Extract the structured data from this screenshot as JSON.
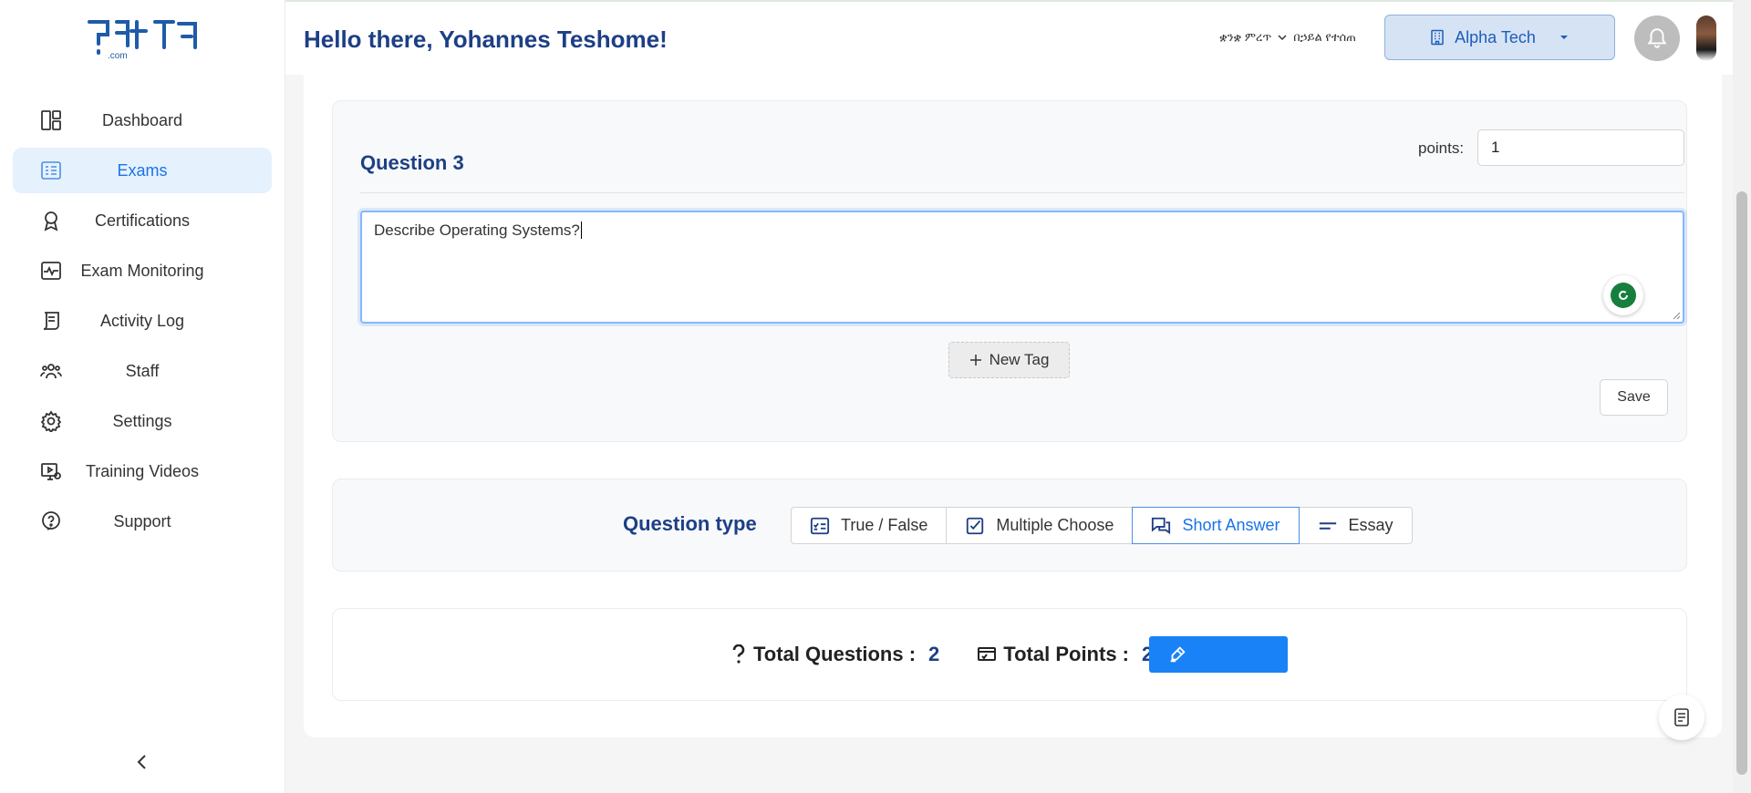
{
  "header": {
    "greeting": "Hello there, Yohannes Teshome!",
    "language_label": "ቋንቋ ምረጥ",
    "language_value": "በኃይል የተሰጠ",
    "org_name": "Alpha Tech"
  },
  "logo": {
    "text": "ፕሬተና",
    "suffix": ".com"
  },
  "sidebar": {
    "items": [
      {
        "label": "Dashboard",
        "icon": "dashboard-icon",
        "active": false
      },
      {
        "label": "Exams",
        "icon": "exams-icon",
        "active": true
      },
      {
        "label": "Certifications",
        "icon": "certificate-icon",
        "active": false
      },
      {
        "label": "Exam Monitoring",
        "icon": "monitoring-icon",
        "active": false
      },
      {
        "label": "Activity Log",
        "icon": "activity-log-icon",
        "active": false
      },
      {
        "label": "Staff",
        "icon": "staff-icon",
        "active": false
      },
      {
        "label": "Settings",
        "icon": "settings-icon",
        "active": false
      },
      {
        "label": "Training Videos",
        "icon": "training-videos-icon",
        "active": false
      },
      {
        "label": "Support",
        "icon": "support-icon",
        "active": false
      }
    ],
    "collapse_icon": "chevron-left-icon"
  },
  "question": {
    "title": "Question 3",
    "points_label": "points:",
    "points_value": "1",
    "text": "Describe Operating Systems?",
    "new_tag_label": "New Tag",
    "save_label": "Save"
  },
  "question_type": {
    "label": "Question type",
    "options": [
      {
        "label": "True / False",
        "icon": "true-false-icon",
        "active": false
      },
      {
        "label": "Multiple Choose",
        "icon": "checkbox-icon",
        "active": false
      },
      {
        "label": "Short Answer",
        "icon": "chat-bubbles-icon",
        "active": true
      },
      {
        "label": "Essay",
        "icon": "essay-lines-icon",
        "active": false
      }
    ]
  },
  "totals": {
    "questions_label": "Total Questions :",
    "questions_value": "2",
    "points_label": "Total Points :",
    "points_value": "2"
  },
  "colors": {
    "brand": "#1d3f86",
    "accent": "#1a82f7",
    "active_bg": "#e5f1fd"
  }
}
